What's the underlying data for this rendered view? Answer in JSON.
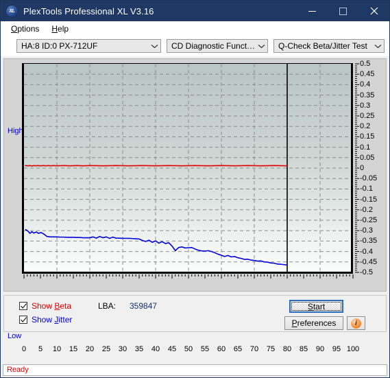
{
  "window": {
    "title": "PlexTools Professional XL V3.16",
    "icon": "XL",
    "icon_name": "plextools-logo-icon",
    "minimize": "minimize-icon",
    "maximize": "maximize-icon",
    "close": "close-icon"
  },
  "menubar": {
    "items": [
      {
        "pre": "",
        "accel": "O",
        "post": "ptions",
        "name": "menu-options"
      },
      {
        "pre": "",
        "accel": "H",
        "post": "elp",
        "name": "menu-help"
      }
    ]
  },
  "toolbar": {
    "drive_select": "HA:8 ID:0  PX-712UF",
    "function_select": "CD Diagnostic Functions",
    "test_select": "Q-Check Beta/Jitter Test"
  },
  "chart_data": {
    "type": "line",
    "title": "",
    "xlabel": "",
    "ylabel": "",
    "xlim": [
      0,
      100
    ],
    "ylim": [
      -0.5,
      0.5
    ],
    "grid": true,
    "legend": "checkbox-toggles",
    "axis_left_top_label": "High",
    "axis_left_bottom_label": "Low",
    "xticks": [
      0,
      5,
      10,
      15,
      20,
      25,
      30,
      35,
      40,
      45,
      50,
      55,
      60,
      65,
      70,
      75,
      80,
      85,
      90,
      95,
      100
    ],
    "xtick_labels": [
      "0",
      "5",
      "10",
      "15",
      "20",
      "25",
      "30",
      "35",
      "40",
      "45",
      "50",
      "55",
      "60",
      "65",
      "70",
      "75",
      "80",
      "85",
      "90",
      "95",
      "100"
    ],
    "yticks": [
      0.5,
      0.45,
      0.4,
      0.35,
      0.3,
      0.25,
      0.2,
      0.15,
      0.1,
      0.05,
      0,
      -0.05,
      -0.1,
      -0.15,
      -0.2,
      -0.25,
      -0.3,
      -0.35,
      -0.4,
      -0.45,
      -0.5
    ],
    "ytick_labels": [
      "0.5",
      "0.45",
      "0.4",
      "0.35",
      "0.3",
      "0.25",
      "0.2",
      "0.15",
      "0.1",
      "0.05",
      "0",
      "-0.05",
      "-0.1",
      "-0.15",
      "-0.2",
      "-0.25",
      "-0.3",
      "-0.35",
      "-0.4",
      "-0.45",
      "-0.5"
    ],
    "data_end_marker_x": 80,
    "series": [
      {
        "name": "Beta",
        "color": "#e00000",
        "x": [
          0.4,
          1.2,
          1.8,
          2.4,
          3.0,
          3.6,
          4.2,
          5.0,
          5.8,
          6.6,
          7.4,
          8.2,
          9.0,
          10,
          12,
          14,
          16,
          18,
          20,
          24,
          28,
          32,
          36,
          40,
          44,
          48,
          52,
          56,
          60,
          64,
          68,
          72,
          76,
          80
        ],
        "values": [
          0.012,
          0.011,
          0.012,
          0.01,
          0.012,
          0.011,
          0.012,
          0.011,
          0.012,
          0.011,
          0.012,
          0.011,
          0.012,
          0.011,
          0.012,
          0.011,
          0.012,
          0.011,
          0.012,
          0.011,
          0.012,
          0.011,
          0.012,
          0.011,
          0.012,
          0.011,
          0.012,
          0.011,
          0.012,
          0.011,
          0.012,
          0.011,
          0.012,
          0.011
        ]
      },
      {
        "name": "Jitter",
        "color": "#0000dd",
        "x": [
          0.5,
          1.2,
          1.8,
          2.4,
          3.0,
          3.7,
          4.4,
          5.2,
          6.0,
          7.0,
          8.0,
          9.0,
          10,
          11,
          12,
          13,
          14,
          15,
          16,
          17,
          18,
          19,
          20,
          21,
          22,
          23,
          24,
          25,
          26,
          27,
          28,
          29,
          30,
          31,
          32,
          33,
          34,
          35,
          36,
          37,
          38,
          39,
          40,
          41,
          42,
          43,
          44,
          45,
          46,
          47,
          48,
          49,
          50,
          51,
          52,
          53,
          54,
          55,
          56,
          57,
          58,
          59,
          60,
          61,
          62,
          63,
          64,
          65,
          66,
          67,
          68,
          69,
          70,
          71,
          72,
          73,
          74,
          75,
          76,
          77,
          78,
          79,
          80
        ],
        "values": [
          -0.295,
          -0.302,
          -0.313,
          -0.305,
          -0.312,
          -0.306,
          -0.313,
          -0.309,
          -0.316,
          -0.328,
          -0.33,
          -0.33,
          -0.33,
          -0.331,
          -0.331,
          -0.332,
          -0.332,
          -0.332,
          -0.333,
          -0.333,
          -0.334,
          -0.334,
          -0.334,
          -0.33,
          -0.336,
          -0.328,
          -0.334,
          -0.33,
          -0.337,
          -0.331,
          -0.336,
          -0.336,
          -0.337,
          -0.337,
          -0.337,
          -0.338,
          -0.339,
          -0.34,
          -0.347,
          -0.352,
          -0.346,
          -0.356,
          -0.349,
          -0.36,
          -0.353,
          -0.362,
          -0.358,
          -0.374,
          -0.396,
          -0.381,
          -0.378,
          -0.383,
          -0.382,
          -0.381,
          -0.388,
          -0.394,
          -0.397,
          -0.398,
          -0.396,
          -0.4,
          -0.406,
          -0.413,
          -0.418,
          -0.424,
          -0.419,
          -0.426,
          -0.424,
          -0.43,
          -0.433,
          -0.438,
          -0.437,
          -0.441,
          -0.443,
          -0.446,
          -0.445,
          -0.45,
          -0.451,
          -0.455,
          -0.456,
          -0.46,
          -0.461,
          -0.463,
          -0.465
        ]
      }
    ]
  },
  "controls": {
    "show_beta": {
      "pre": "Show ",
      "accel": "B",
      "post": "eta",
      "checked": true
    },
    "show_jitter": {
      "pre": "Show ",
      "accel": "J",
      "post": "itter",
      "checked": true
    },
    "lba_label": "LBA:",
    "lba_value": "359847",
    "start": {
      "pre": "",
      "accel": "S",
      "post": "tart"
    },
    "preferences": {
      "pre": "",
      "accel": "P",
      "post": "references"
    },
    "info_icon": "i"
  },
  "statusbar": {
    "text": "Ready"
  }
}
